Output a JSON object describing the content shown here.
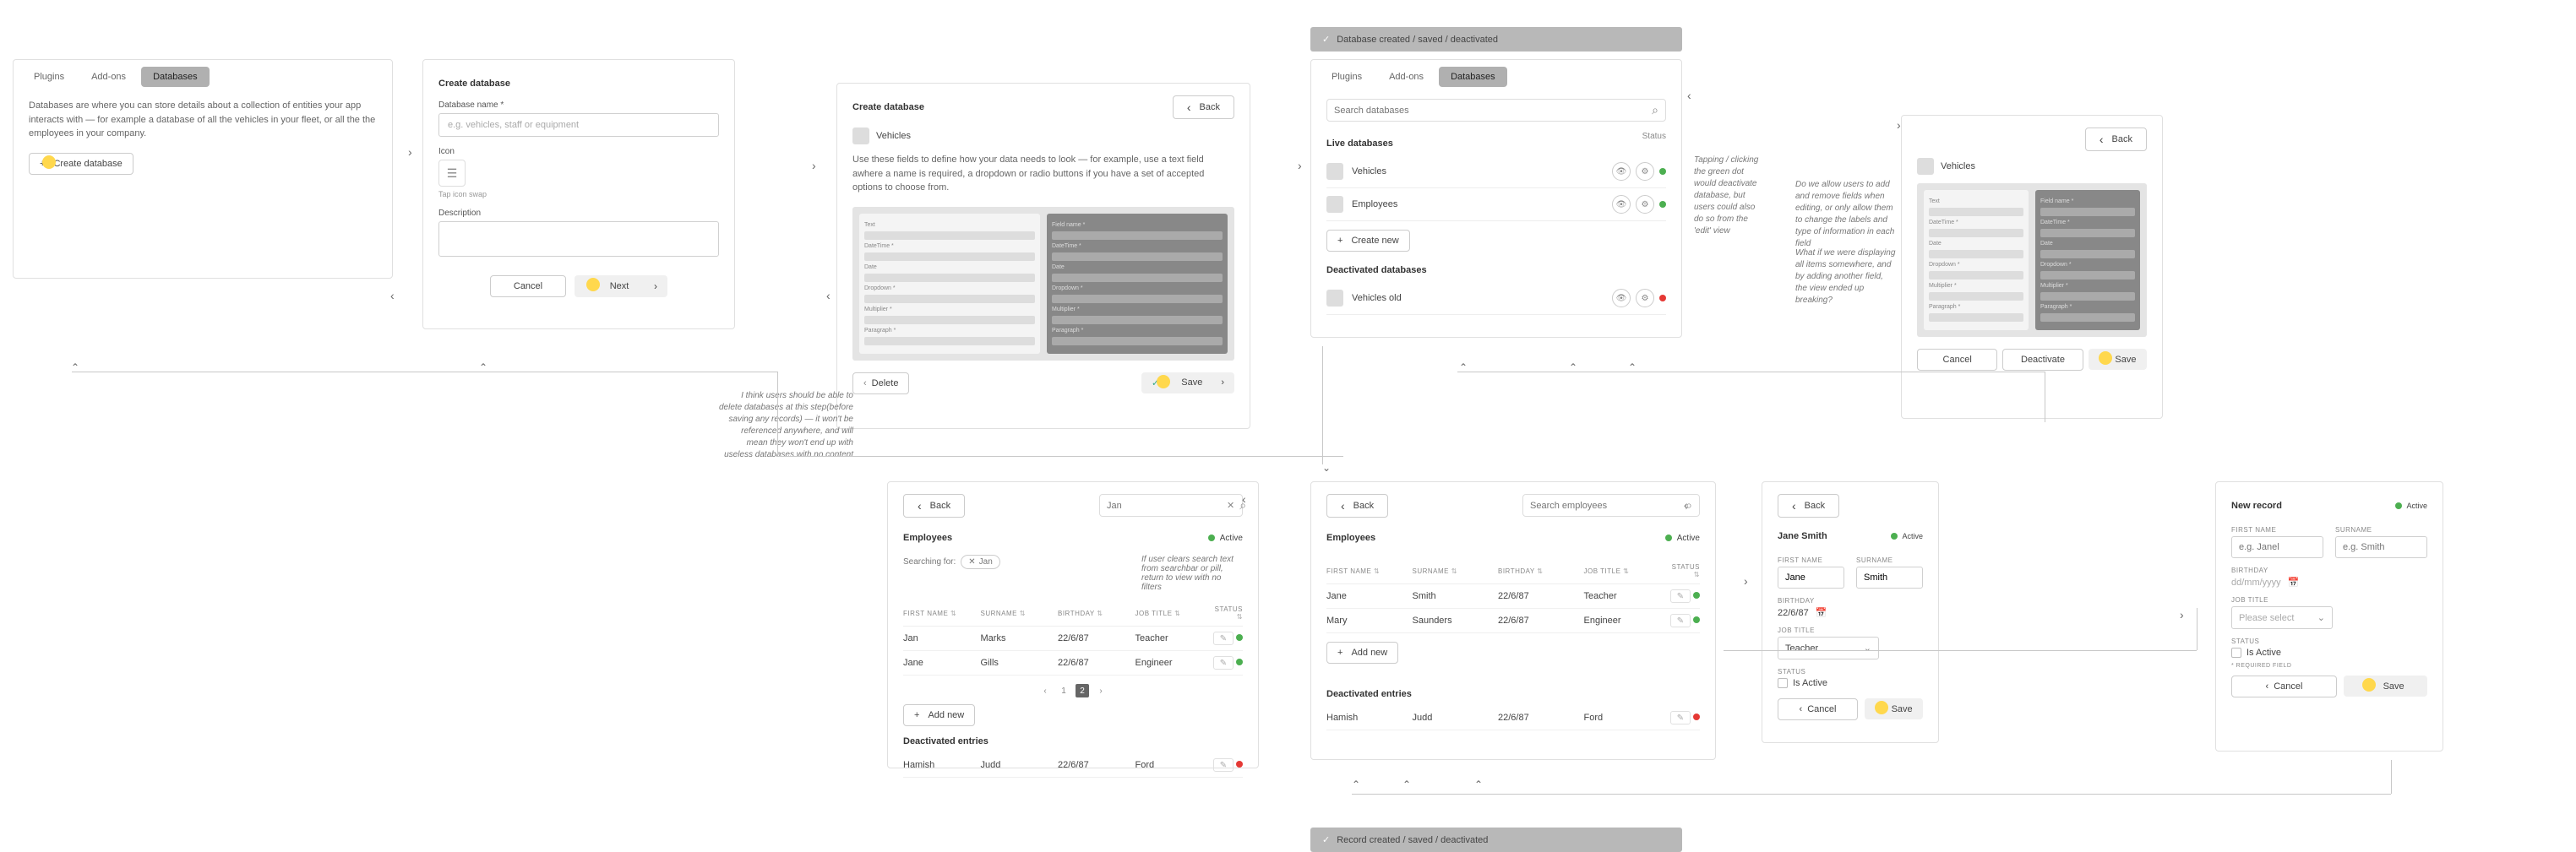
{
  "tabs": {
    "plugins": "Plugins",
    "addons": "Add-ons",
    "databases": "Databases"
  },
  "buttons": {
    "back": "Back",
    "cancel": "Cancel",
    "next": "Next",
    "save": "Save",
    "delete": "Delete",
    "deactivate": "Deactivate",
    "create_db": "Create database",
    "create_new": "Create new",
    "add_new": "Add new"
  },
  "screen1": {
    "helper": "Databases are where you can store details about a collection of entities your app interacts with — for example a database of all the vehicles in your fleet, or all the the employees in your company."
  },
  "screen2": {
    "title": "Create database",
    "name_label": "Database name *",
    "name_placeholder": "e.g. vehicles, staff or equipment",
    "icon_label": "Icon",
    "icon_hint": "Tap icon swap",
    "desc_label": "Description"
  },
  "screen3": {
    "title": "Create database",
    "db_name": "Vehicles",
    "helper": "Use these fields to define how your data needs to look — for example, use a text field awhere a name is required, a dropdown or radio buttons if you have a set of accepted options to choose from.",
    "field_labels": [
      "Text",
      "Field name *",
      "DateTime *",
      "Date",
      "Dropdown *",
      "Multiplier *",
      "Paragraph *"
    ]
  },
  "annotation_delete": "I think users should be able to delete databases at this step(before saving any records) — it won't be referenced anywhere, and will mean they won't end up with useless databases with no content",
  "toast1": "Database created / saved / deactivated",
  "toast2": "Record created / saved / deactivated",
  "screen4": {
    "search_placeholder": "Search databases",
    "live_title": "Live databases",
    "status_header": "Status",
    "rows": [
      {
        "name": "Vehicles"
      },
      {
        "name": "Employees"
      }
    ],
    "deact_title": "Deactivated databases",
    "deact_rows": [
      {
        "name": "Vehicles old"
      }
    ]
  },
  "annotation_tapping": "Tapping / clicking the green dot would deactivate database, but users could also do so from the 'edit' view",
  "screen5": {
    "db_name": "Vehicles",
    "helper": "Do we allow users to add and remove fields when editing, or only allow them to change the labels and type of information in each field",
    "field_labels": [
      "Text",
      "Field name *",
      "DateTime *",
      "Date",
      "Dropdown *",
      "Multiplier *",
      "Paragraph *"
    ]
  },
  "annotation_whatif": "What if we were displaying all items somewhere, and by adding another field, the view ended up breaking?",
  "screen6": {
    "name": "Employees",
    "status": "Active",
    "search_placeholder": "Jan",
    "searching_for": "Searching for:",
    "chip": "Jan",
    "note": "If user clears search text from searchbar or pill, return to view with no filters",
    "headers": [
      "FIRST NAME",
      "SURNAME",
      "BIRTHDAY",
      "JOB TITLE",
      "STATUS"
    ],
    "rows": [
      {
        "first": "Jan",
        "sur": "Marks",
        "bday": "22/6/87",
        "job": "Teacher",
        "status": "green"
      },
      {
        "first": "Jane",
        "sur": "Gills",
        "bday": "22/6/87",
        "job": "Engineer",
        "status": "green"
      }
    ],
    "deact_title": "Deactivated entries",
    "deact_rows": [
      {
        "first": "Hamish",
        "sur": "Judd",
        "bday": "22/6/87",
        "job": "Ford",
        "status": "red"
      }
    ],
    "pager": [
      "‹",
      "1",
      "2",
      "›"
    ]
  },
  "screen7": {
    "name": "Employees",
    "status": "Active",
    "search_placeholder": "Search employees",
    "headers": [
      "FIRST NAME",
      "SURNAME",
      "BIRTHDAY",
      "JOB TITLE",
      "STATUS"
    ],
    "rows": [
      {
        "first": "Jane",
        "sur": "Smith",
        "bday": "22/6/87",
        "job": "Teacher",
        "status": "green"
      },
      {
        "first": "Mary",
        "sur": "Saunders",
        "bday": "22/6/87",
        "job": "Engineer",
        "status": "green"
      }
    ],
    "deact_title": "Deactivated entries",
    "deact_rows": [
      {
        "first": "Hamish",
        "sur": "Judd",
        "bday": "22/6/87",
        "job": "Ford",
        "status": "red"
      }
    ]
  },
  "screen8": {
    "title": "Jane Smith",
    "status": "Active",
    "fname_label": "FIRST NAME",
    "fname": "Jane",
    "sname_label": "SURNAME",
    "sname": "Smith",
    "bday_label": "BIRTHDAY",
    "bday": "22/6/87",
    "job_label": "JOB TITLE",
    "job": "Teacher",
    "status_label": "STATUS",
    "status_val": "Is Active"
  },
  "screen9": {
    "title": "New record",
    "status": "Active",
    "fname_label": "FIRST NAME",
    "fname_ph": "e.g. Janel",
    "sname_label": "SURNAME",
    "sname_ph": "e.g. Smith",
    "bday_label": "BIRTHDAY",
    "bday_ph": "dd/mm/yyyy",
    "job_label": "JOB TITLE",
    "job_ph": "Please select",
    "status_label": "STATUS",
    "status_val": "Is Active",
    "req_label": "* REQUIRED FIELD"
  }
}
